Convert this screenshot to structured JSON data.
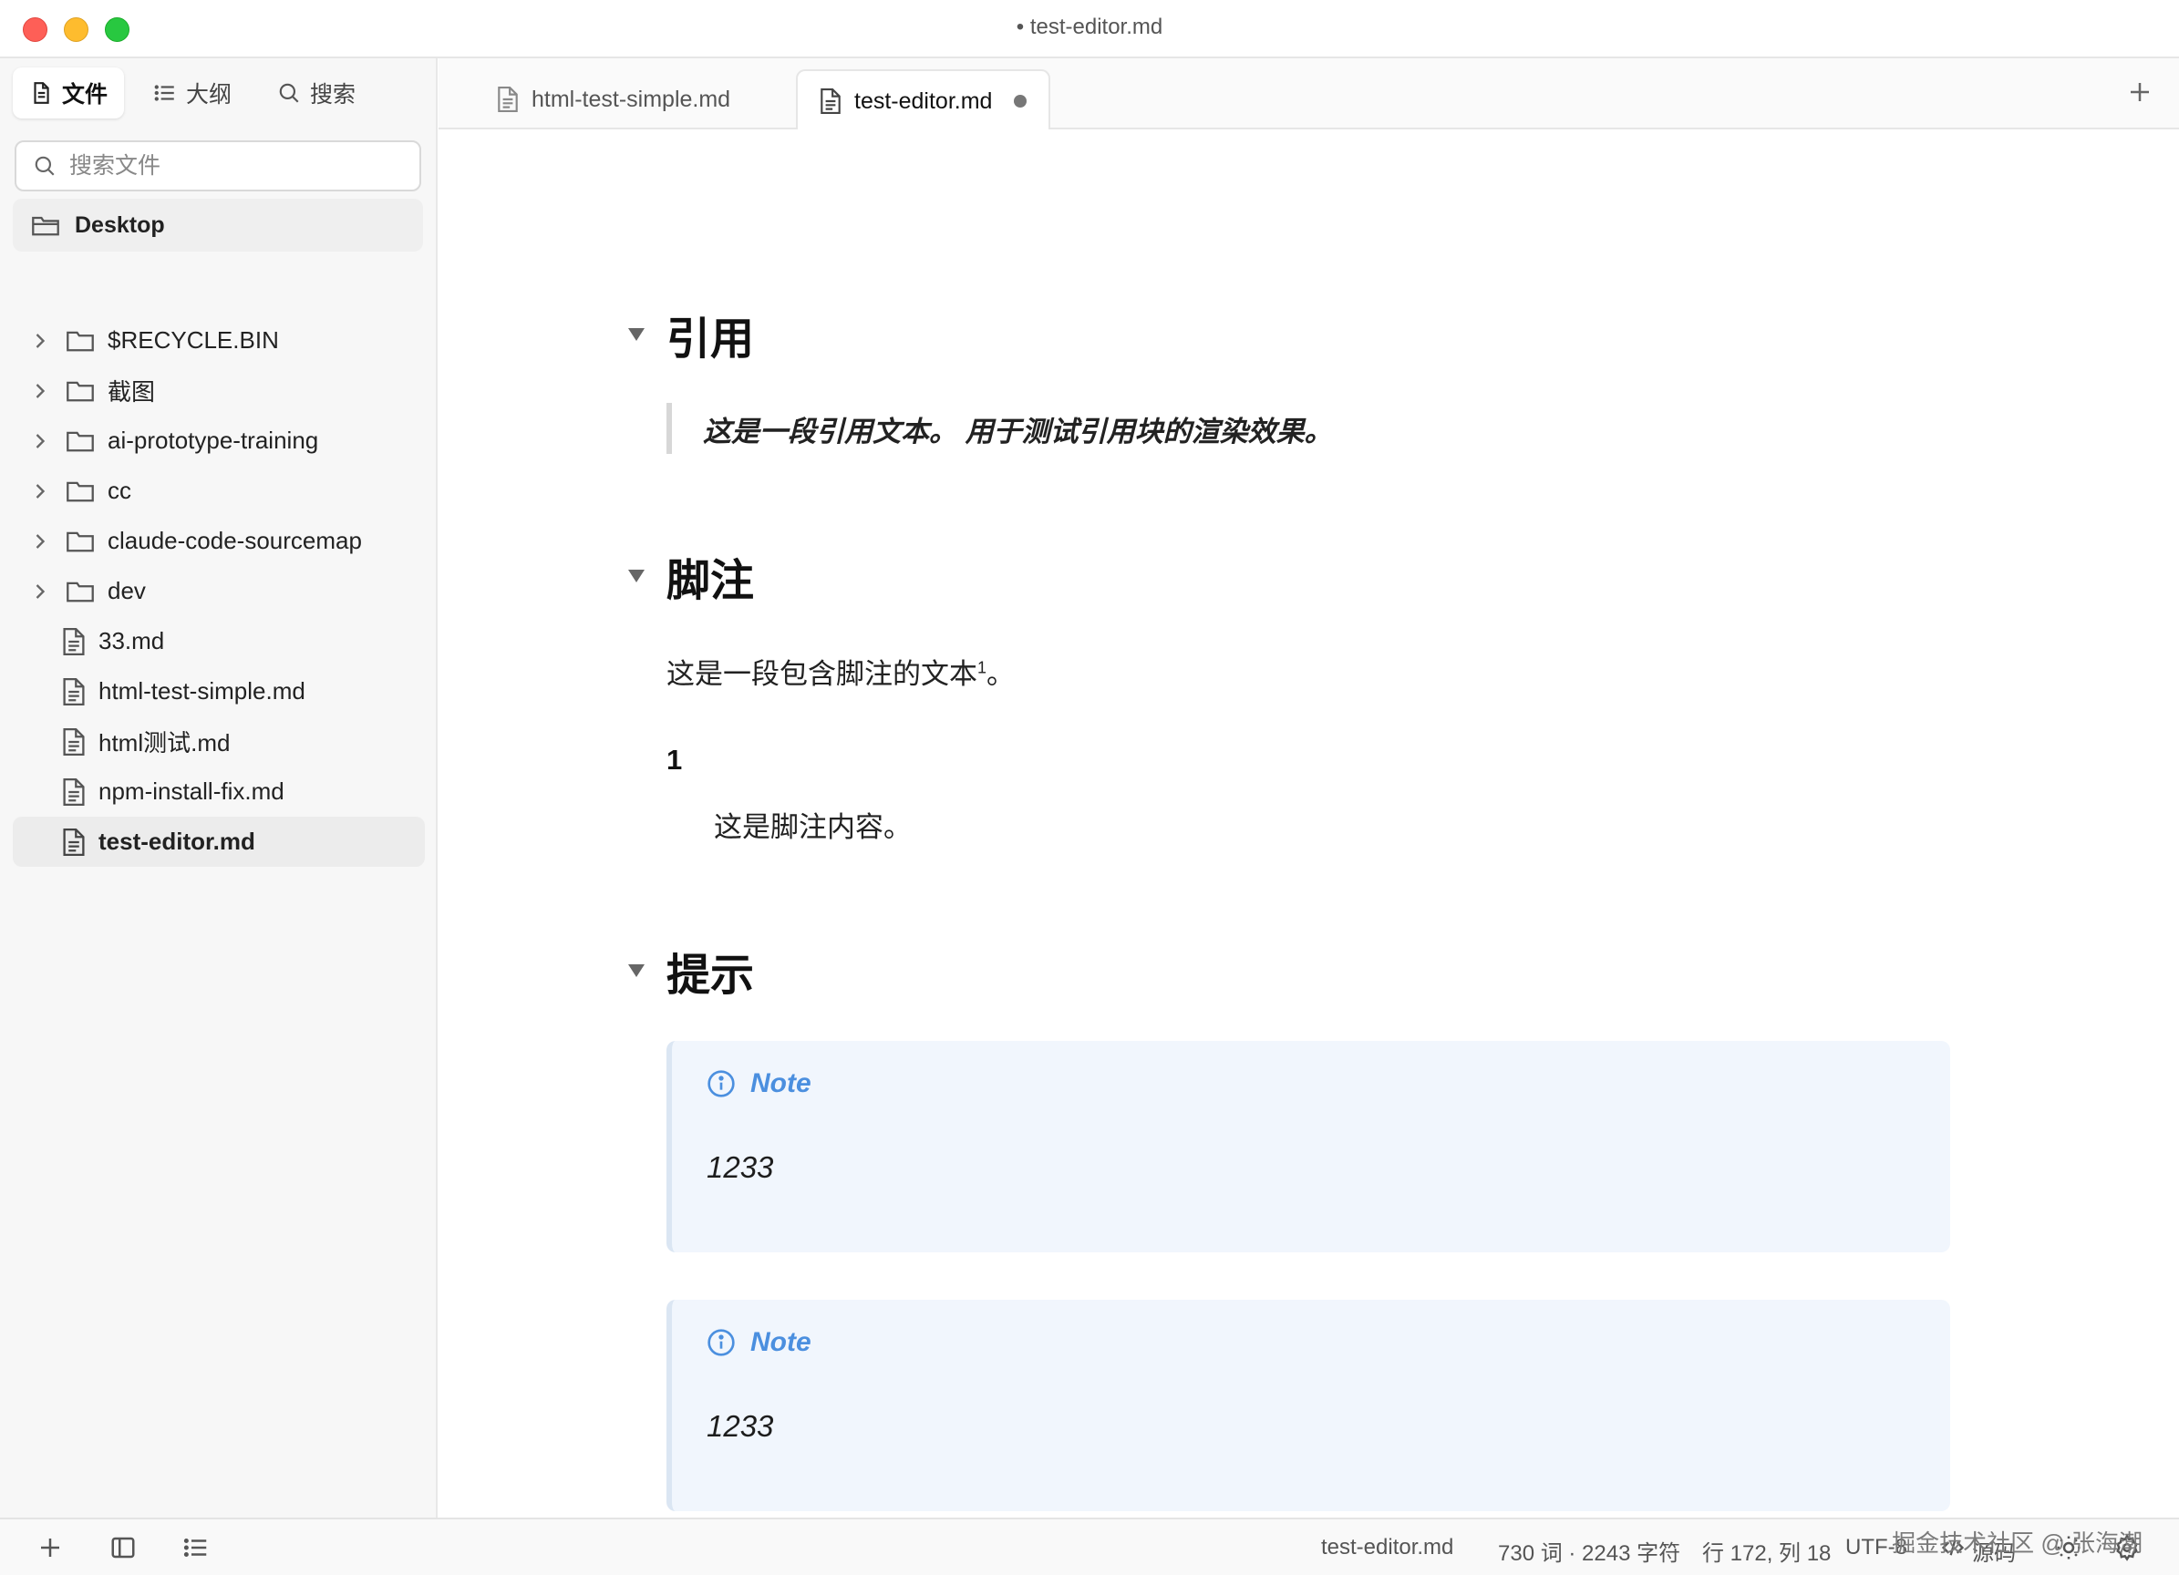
{
  "window": {
    "title": "• test-editor.md"
  },
  "sidebar": {
    "tabs": [
      {
        "label": "文件",
        "icon": "file-icon",
        "active": true
      },
      {
        "label": "大纲",
        "icon": "list-icon",
        "active": false
      },
      {
        "label": "搜索",
        "icon": "search-icon",
        "active": false
      }
    ],
    "search_placeholder": "搜索文件",
    "root_folder": "Desktop",
    "items": [
      {
        "label": "$RECYCLE.BIN",
        "type": "folder"
      },
      {
        "label": "截图",
        "type": "folder"
      },
      {
        "label": "ai-prototype-training",
        "type": "folder"
      },
      {
        "label": "cc",
        "type": "folder"
      },
      {
        "label": "claude-code-sourcemap",
        "type": "folder"
      },
      {
        "label": "dev",
        "type": "folder"
      },
      {
        "label": "33.md",
        "type": "file"
      },
      {
        "label": "html-test-simple.md",
        "type": "file"
      },
      {
        "label": "html测试.md",
        "type": "file"
      },
      {
        "label": "npm-install-fix.md",
        "type": "file"
      },
      {
        "label": "test-editor.md",
        "type": "file",
        "active": true
      }
    ]
  },
  "tabs": [
    {
      "label": "html-test-simple.md",
      "active": false
    },
    {
      "label": "test-editor.md",
      "active": true,
      "unsaved": true
    }
  ],
  "doc": {
    "h_quote": "引用",
    "quote_text": "这是一段引用文本。 用于测试引用块的渲染效果。",
    "h_footnote": "脚注",
    "footnote_para": "这是一段包含脚注的文本",
    "footnote_ref": "1",
    "footnote_para_end": "。",
    "footnote_num": "1",
    "footnote_text": "这是脚注内容。",
    "h_tip": "提示",
    "callouts": [
      {
        "title": "Note",
        "body": "1233"
      },
      {
        "title": "Note",
        "body": "1233"
      }
    ]
  },
  "status": {
    "filename": "test-editor.md",
    "counts": "730 词 · 2243 字符",
    "position": "行 172, 列 18",
    "encoding": "UTF-8",
    "source_label": "源码",
    "watermark": "掘金技术社区 @ 张海潮"
  },
  "colors": {
    "accent": "#4b8fdf",
    "callout_bg": "#f1f6fd",
    "close": "#fe5f57",
    "minimize": "#febc2e",
    "maximize": "#28c840"
  }
}
